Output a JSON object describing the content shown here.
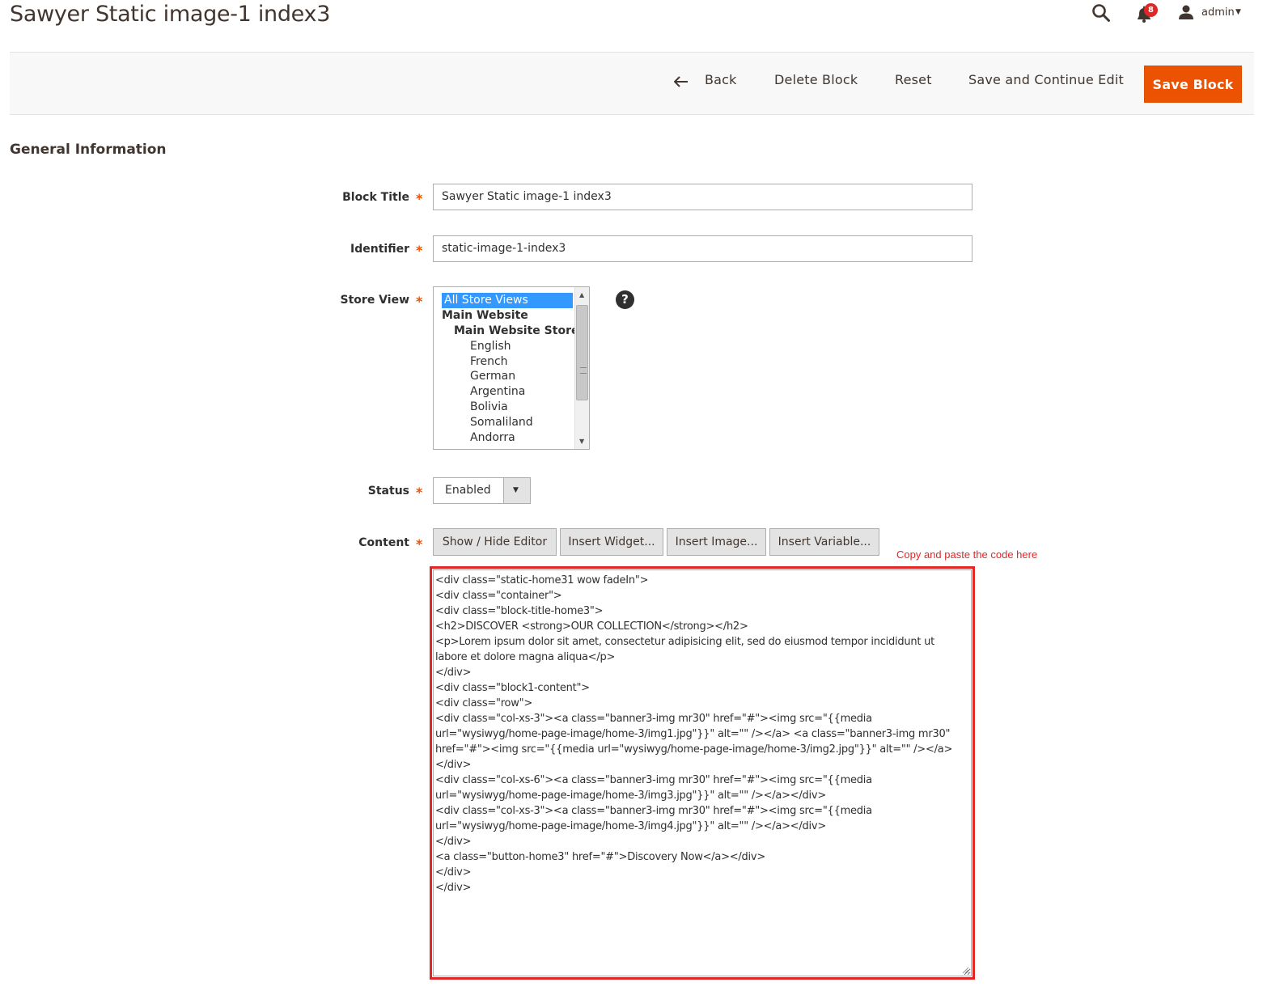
{
  "page": {
    "title": "Sawyer Static image-1 index3"
  },
  "header": {
    "notifications_count": "8",
    "user_name": "admin"
  },
  "toolbar": {
    "back_label": "Back",
    "delete_label": "Delete Block",
    "reset_label": "Reset",
    "save_continue_label": "Save and Continue Edit",
    "save_label": "Save Block"
  },
  "section": {
    "title": "General Information"
  },
  "form": {
    "block_title": {
      "label": "Block Title",
      "value": "Sawyer Static image-1 index3"
    },
    "identifier": {
      "label": "Identifier",
      "value": "static-image-1-index3"
    },
    "store_view": {
      "label": "Store View",
      "help": "?",
      "options": [
        "All Store Views",
        "Main Website",
        "Main Website Store",
        "English",
        "French",
        "German",
        "Argentina",
        "Bolivia",
        "Somaliland",
        "Andorra"
      ],
      "selected": "All Store Views"
    },
    "status": {
      "label": "Status",
      "value": "Enabled"
    },
    "content": {
      "label": "Content",
      "buttons": [
        "Show / Hide Editor",
        "Insert Widget...",
        "Insert Image...",
        "Insert Variable..."
      ],
      "hint": "Copy and paste the code here",
      "code_lines": [
        "<div class=\"static-home31 wow fadeIn\">",
        "<div class=\"container\">",
        "<div class=\"block-title-home3\">",
        "<h2>DISCOVER <strong>OUR COLLECTION</strong></h2>",
        "<p>Lorem ipsum dolor sit amet, consectetur adipisicing elit, sed do eiusmod tempor incididunt ut labore et dolore magna aliqua</p>",
        "</div>",
        "<div class=\"block1-content\">",
        "<div class=\"row\">",
        "<div class=\"col-xs-3\"><a class=\"banner3-img mr30\" href=\"#\"><img src=\"{{media url=\"wysiwyg/home-page-image/home-3/img1.jpg\"}}\" alt=\"\" /></a> <a class=\"banner3-img mr30\" href=\"#\"><img src=\"{{media url=\"wysiwyg/home-page-image/home-3/img2.jpg\"}}\" alt=\"\" /></a></div>",
        "<div class=\"col-xs-6\"><a class=\"banner3-img mr30\" href=\"#\"><img src=\"{{media url=\"wysiwyg/home-page-image/home-3/img3.jpg\"}}\" alt=\"\" /></a></div>",
        "<div class=\"col-xs-3\"><a class=\"banner3-img mr30\" href=\"#\"><img src=\"{{media url=\"wysiwyg/home-page-image/home-3/img4.jpg\"}}\" alt=\"\" /></a></div>",
        "</div>",
        "<a class=\"button-home3\" href=\"#\">Discovery Now</a></div>",
        "</div>",
        "</div>"
      ]
    },
    "required_mark": "*"
  },
  "colors": {
    "primary_button": "#eb5202",
    "required": "#eb5202",
    "highlight": "#e22626",
    "selected_option": "#3399ff"
  },
  "icons": {
    "search": "search-icon",
    "notifications": "bell-icon",
    "user": "user-icon",
    "back": "arrow-left-icon",
    "help": "question-icon",
    "dropdown": "chevron-down-icon"
  }
}
